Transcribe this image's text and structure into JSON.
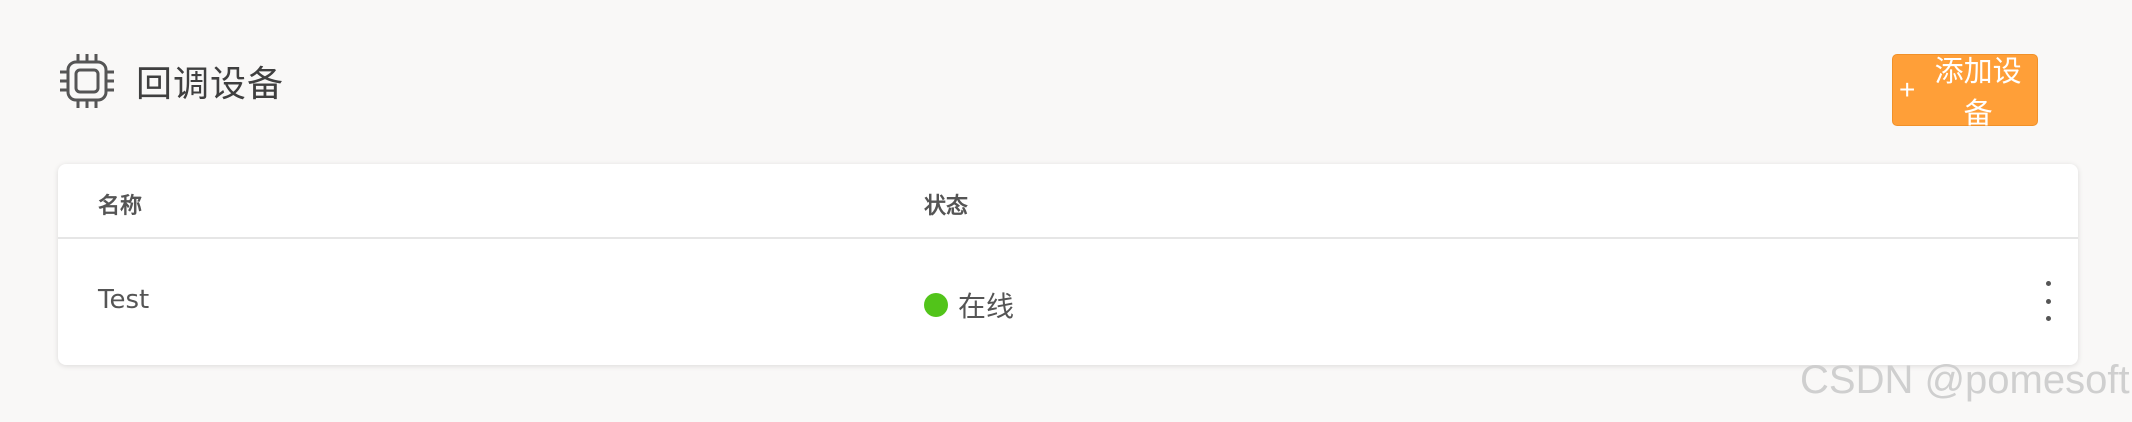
{
  "header": {
    "title": "回调设备",
    "icon": "chip-icon"
  },
  "toolbar": {
    "add_plus": "+",
    "add_label": "添加设备",
    "accent_color": "#ff9f38"
  },
  "table": {
    "columns": [
      "名称",
      "状态"
    ],
    "rows": [
      {
        "name": "Test",
        "status": "在线",
        "status_color": "#52c41a"
      }
    ]
  },
  "watermark": "CSDN @pomesoft"
}
